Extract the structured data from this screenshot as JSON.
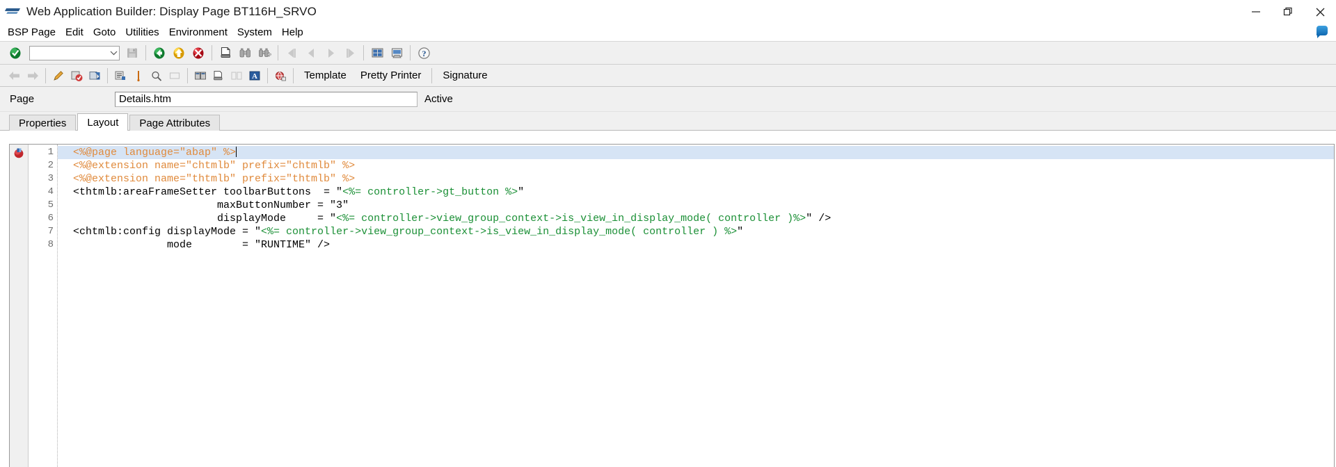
{
  "window": {
    "title": "Web Application Builder: Display Page BT116H_SRVO",
    "logo_icon": "sap-logo-icon",
    "minimize_label": "Minimize",
    "restore_label": "Restore",
    "close_label": "Close"
  },
  "menubar": {
    "items": [
      {
        "label": "BSP Page"
      },
      {
        "label": "Edit"
      },
      {
        "label": "Goto"
      },
      {
        "label": "Utilities"
      },
      {
        "label": "Environment"
      },
      {
        "label": "System"
      },
      {
        "label": "Help"
      }
    ],
    "right_icon": "sap-help-bubble-icon"
  },
  "toolbar_main": {
    "command_field": {
      "value": "",
      "placeholder": ""
    },
    "command_dropdown_icon": "chevron-down-icon",
    "buttons": [
      {
        "name": "enter-check-button",
        "icon": "green-check-icon",
        "enabled": true
      },
      {
        "name": "save-button",
        "icon": "save-disk-icon",
        "enabled": false
      },
      {
        "name": "back-button",
        "icon": "green-back-arrow-icon",
        "enabled": true
      },
      {
        "name": "exit-button",
        "icon": "yellow-up-arrow-icon",
        "enabled": true
      },
      {
        "name": "cancel-button",
        "icon": "red-cancel-icon",
        "enabled": true
      },
      {
        "name": "print-button",
        "icon": "printer-icon",
        "enabled": true
      },
      {
        "name": "find-button",
        "icon": "binoculars-icon",
        "enabled": true
      },
      {
        "name": "find-next-button",
        "icon": "binoculars-plus-icon",
        "enabled": true
      },
      {
        "name": "first-page-button",
        "icon": "first-page-icon",
        "enabled": false
      },
      {
        "name": "previous-page-button",
        "icon": "previous-page-icon",
        "enabled": false
      },
      {
        "name": "next-page-button",
        "icon": "next-page-icon",
        "enabled": false
      },
      {
        "name": "last-page-button",
        "icon": "last-page-icon",
        "enabled": false
      },
      {
        "name": "create-session-button",
        "icon": "new-session-icon",
        "enabled": true
      },
      {
        "name": "create-shortcut-button",
        "icon": "shortcut-icon",
        "enabled": true
      },
      {
        "name": "help-button",
        "icon": "question-help-icon",
        "enabled": true
      }
    ]
  },
  "toolbar_secondary": {
    "buttons": [
      {
        "name": "back-nav-button",
        "icon": "left-arrow-icon",
        "enabled": false
      },
      {
        "name": "forward-nav-button",
        "icon": "right-arrow-icon",
        "enabled": false
      },
      {
        "name": "display-change-button",
        "icon": "pencil-icon",
        "enabled": true
      },
      {
        "name": "check-syntax-button",
        "icon": "check-object-icon",
        "enabled": true
      },
      {
        "name": "activate-button",
        "icon": "activate-icon",
        "enabled": true
      },
      {
        "name": "where-used-button",
        "icon": "where-used-list-icon",
        "enabled": true
      },
      {
        "name": "insert-point-button",
        "icon": "orange-marker-icon",
        "enabled": true
      },
      {
        "name": "navigate-button",
        "icon": "navigate-icon",
        "enabled": true
      },
      {
        "name": "unmark-button",
        "icon": "unmark-icon",
        "enabled": false
      },
      {
        "name": "split-screen-button",
        "icon": "split-screen-icon",
        "enabled": true
      },
      {
        "name": "print-preview-button",
        "icon": "print-preview-icon",
        "enabled": true
      },
      {
        "name": "compare-button",
        "icon": "compare-icon",
        "enabled": false
      },
      {
        "name": "properties-info-button",
        "icon": "blue-info-icon",
        "enabled": true
      },
      {
        "name": "browser-preview-button",
        "icon": "browser-test-icon",
        "enabled": true
      }
    ],
    "text_buttons": [
      {
        "name": "template-button",
        "label": "Template"
      },
      {
        "name": "pretty-printer-button",
        "label": "Pretty Printer"
      },
      {
        "name": "signature-button",
        "label": "Signature"
      }
    ]
  },
  "page_row": {
    "label": "Page",
    "value": "Details.htm",
    "placeholder": "",
    "status": "Active"
  },
  "tabs": [
    {
      "label": "Properties",
      "active": false
    },
    {
      "label": "Layout",
      "active": true
    },
    {
      "label": "Page Attributes",
      "active": false
    }
  ],
  "editor": {
    "breakpoint_icon": "bookmark-marker-icon",
    "line_numbers": [
      "1",
      "2",
      "3",
      "4",
      "5",
      "6",
      "7",
      "8"
    ],
    "lines": [
      {
        "number": "1",
        "current": true,
        "segments": [
          {
            "cls": "tok-dir",
            "text": "<%@page language=\"abap\" %>"
          }
        ]
      },
      {
        "number": "2",
        "current": false,
        "segments": [
          {
            "cls": "tok-dir",
            "text": "<%@extension name=\"chtmlb\" prefix=\"chtmlb\" %>"
          }
        ]
      },
      {
        "number": "3",
        "current": false,
        "segments": [
          {
            "cls": "tok-dir",
            "text": "<%@extension name=\"thtmlb\" prefix=\"thtmlb\" %>"
          }
        ]
      },
      {
        "number": "4",
        "current": false,
        "segments": [
          {
            "cls": "tok-tag",
            "text": "<thtmlb:areaFrameSetter toolbarButtons  = \""
          },
          {
            "cls": "tok-abap",
            "text": "<%= controller->gt_button %>"
          },
          {
            "cls": "tok-tag",
            "text": "\""
          }
        ]
      },
      {
        "number": "5",
        "current": false,
        "segments": [
          {
            "cls": "tok-tag",
            "text": "                       maxButtonNumber = \"3\""
          }
        ]
      },
      {
        "number": "6",
        "current": false,
        "segments": [
          {
            "cls": "tok-tag",
            "text": "                       displayMode     = \""
          },
          {
            "cls": "tok-abap",
            "text": "<%= controller->view_group_context->is_view_in_display_mode( controller )%>"
          },
          {
            "cls": "tok-tag",
            "text": "\" />"
          }
        ]
      },
      {
        "number": "7",
        "current": false,
        "segments": [
          {
            "cls": "tok-tag",
            "text": "<chtmlb:config displayMode = \""
          },
          {
            "cls": "tok-abap",
            "text": "<%= controller->view_group_context->is_view_in_display_mode( controller ) %>"
          },
          {
            "cls": "tok-tag",
            "text": "\""
          }
        ]
      },
      {
        "number": "8",
        "current": false,
        "segments": [
          {
            "cls": "tok-tag",
            "text": "               mode        = \"RUNTIME\" />"
          }
        ]
      }
    ]
  }
}
